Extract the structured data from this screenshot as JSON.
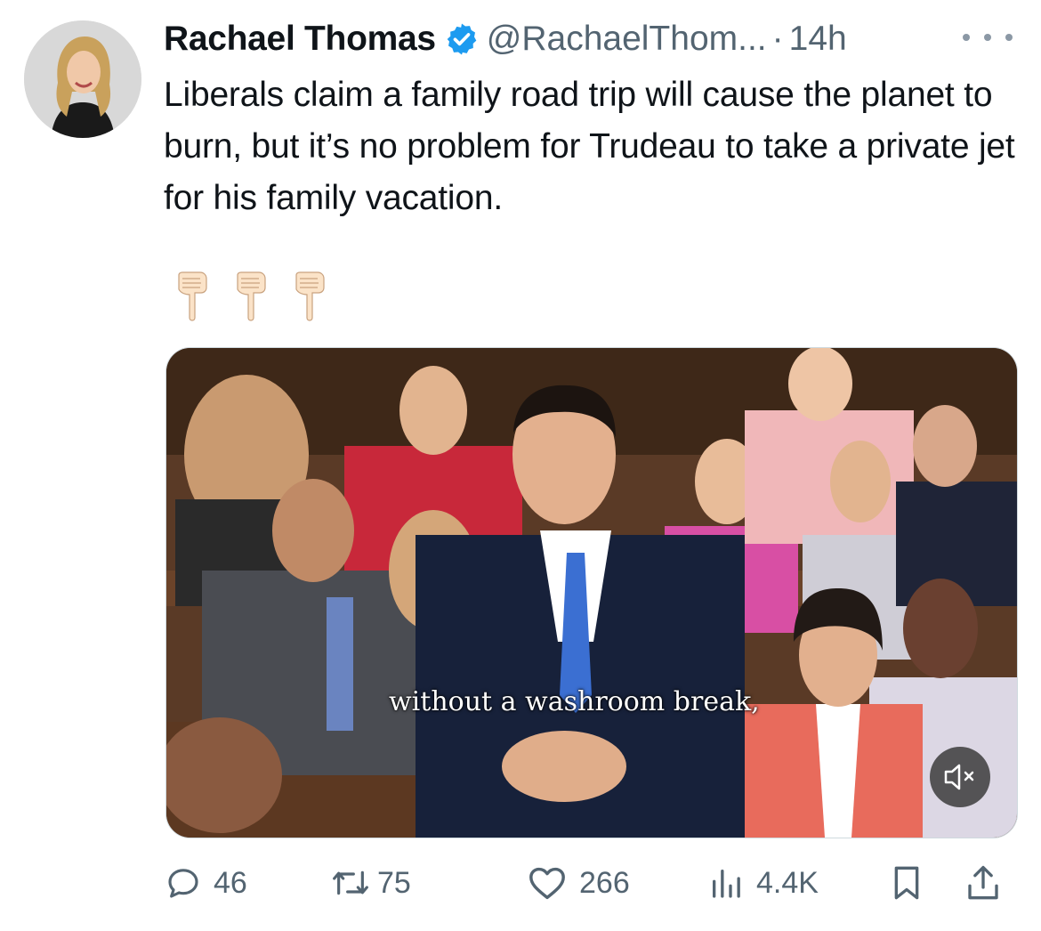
{
  "author": {
    "name": "Rachael Thomas",
    "handle": "@RachaelThom...",
    "separator": "·",
    "time": "14h"
  },
  "tweet": {
    "text": "Liberals claim a family road trip will cause the planet to burn, but it’s no problem for Trudeau to take a private jet for his family vacation.",
    "emoji_count": 3
  },
  "media": {
    "caption": "without a washroom break,"
  },
  "actions": {
    "replies": "46",
    "reposts": "75",
    "likes": "266",
    "views": "4.4K"
  },
  "icons": {
    "verified": "verified-badge-icon",
    "more": "more-options-icon",
    "reply": "reply-bubble-icon",
    "repost": "repost-arrows-icon",
    "like": "heart-icon",
    "views": "views-bars-icon",
    "bookmark": "bookmark-icon",
    "share": "share-icon",
    "mute": "speaker-muted-icon"
  },
  "colors": {
    "text": "#0f1419",
    "secondary": "#536471",
    "verified": "#1d9bf0"
  }
}
